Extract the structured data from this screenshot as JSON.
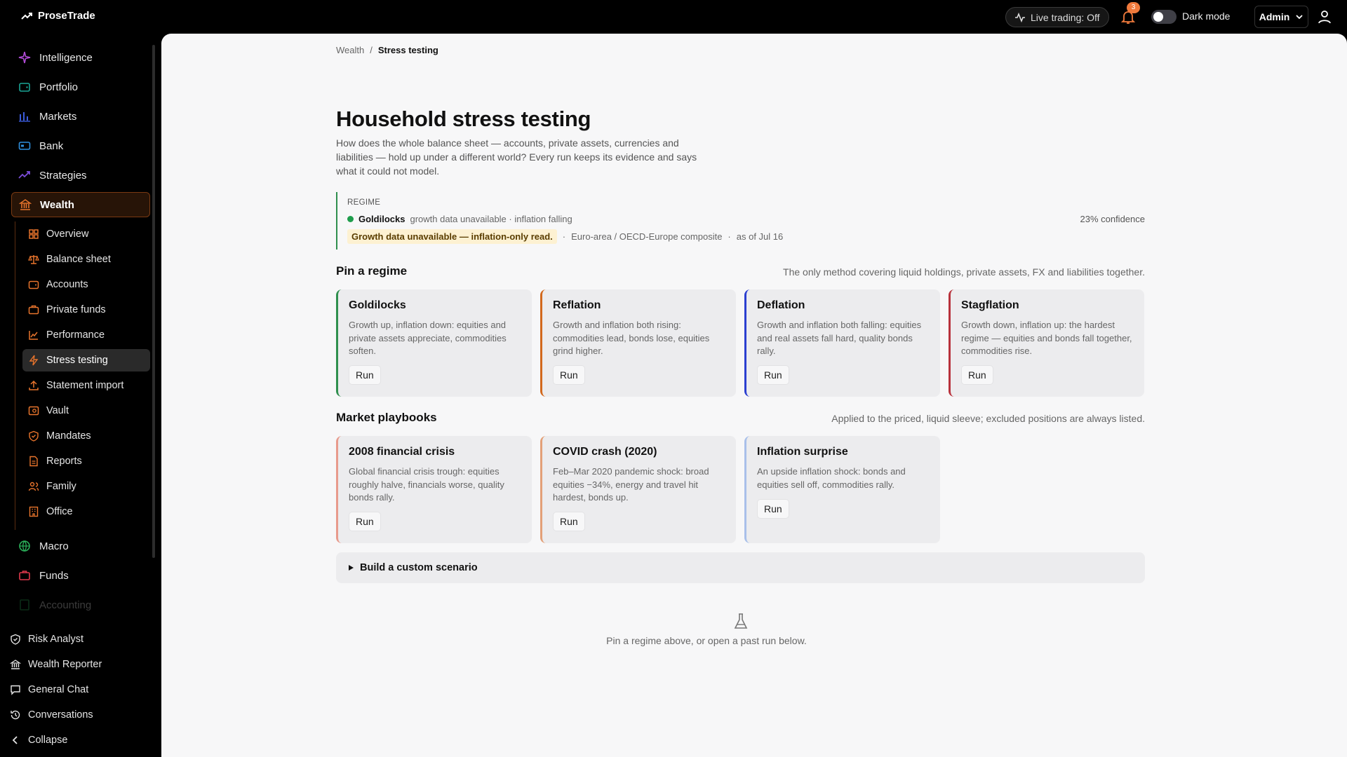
{
  "app": {
    "name": "ProseTrade"
  },
  "topbar": {
    "live_trading": "Live trading: Off",
    "notification_count": "3",
    "dark_mode_label": "Dark mode",
    "user_menu": "Admin"
  },
  "sidebar": {
    "items": [
      {
        "label": "Intelligence",
        "icon": "sparkle-icon",
        "color": "#b04bd6"
      },
      {
        "label": "Portfolio",
        "icon": "wallet-icon",
        "color": "#1aa595"
      },
      {
        "label": "Markets",
        "icon": "bar-chart-icon",
        "color": "#3b5bdb"
      },
      {
        "label": "Bank",
        "icon": "card-icon",
        "color": "#2f8fdd"
      },
      {
        "label": "Strategies",
        "icon": "trend-up-icon",
        "color": "#7c4ddb"
      },
      {
        "label": "Wealth",
        "icon": "bank-icon",
        "color": "#e8742c"
      }
    ],
    "wealth_sub": [
      {
        "label": "Overview",
        "icon": "grid-icon"
      },
      {
        "label": "Balance sheet",
        "icon": "scale-icon"
      },
      {
        "label": "Accounts",
        "icon": "wallet-icon"
      },
      {
        "label": "Private funds",
        "icon": "briefcase-icon"
      },
      {
        "label": "Performance",
        "icon": "line-chart-icon"
      },
      {
        "label": "Stress testing",
        "icon": "bolt-icon"
      },
      {
        "label": "Statement import",
        "icon": "upload-icon"
      },
      {
        "label": "Vault",
        "icon": "vault-icon"
      },
      {
        "label": "Mandates",
        "icon": "shield-check-icon"
      },
      {
        "label": "Reports",
        "icon": "document-icon"
      },
      {
        "label": "Family",
        "icon": "users-icon"
      },
      {
        "label": "Office",
        "icon": "building-icon"
      }
    ],
    "more_items": [
      {
        "label": "Macro",
        "icon": "globe-icon",
        "color": "#2bb05a"
      },
      {
        "label": "Funds",
        "icon": "briefcase-icon",
        "color": "#e0394c"
      },
      {
        "label": "Accounting",
        "icon": "ledger-icon",
        "color": "#2bb05a"
      }
    ],
    "bottom": [
      {
        "label": "Risk Analyst",
        "icon": "shield-icon"
      },
      {
        "label": "Wealth Reporter",
        "icon": "bank-icon"
      },
      {
        "label": "General Chat",
        "icon": "chat-icon"
      },
      {
        "label": "Conversations",
        "icon": "history-icon"
      },
      {
        "label": "Collapse",
        "icon": "chevron-left-icon"
      }
    ],
    "accent": "#e8742c"
  },
  "breadcrumb": {
    "parent": "Wealth",
    "separator": "/",
    "current": "Stress testing"
  },
  "page": {
    "title": "Household stress testing",
    "intro": "How does the whole balance sheet — accounts, private assets, currencies and liabilities — hold up under a different world? Every run keeps its evidence and says what it could not model."
  },
  "regime": {
    "label": "REGIME",
    "name": "Goldilocks",
    "detail": "growth data unavailable · inflation falling",
    "confidence": "23% confidence",
    "warning": "Growth data unavailable — inflation-only read.",
    "source": "Euro-area / OECD-Europe composite",
    "asof": "as of Jul 16",
    "dot_sep": "·"
  },
  "pin_section": {
    "title": "Pin a regime",
    "note": "The only method covering liquid holdings, private assets, FX and liabilities together.",
    "cards": [
      {
        "title": "Goldilocks",
        "desc": "Growth up, inflation down: equities and private assets appreciate, commodities soften.",
        "run": "Run",
        "color": "#2f8f4e"
      },
      {
        "title": "Reflation",
        "desc": "Growth and inflation both rising: commodities lead, bonds lose, equities grind higher.",
        "run": "Run",
        "color": "#d2691e"
      },
      {
        "title": "Deflation",
        "desc": "Growth and inflation both falling: equities and real assets fall hard, quality bonds rally.",
        "run": "Run",
        "color": "#2b3fd0"
      },
      {
        "title": "Stagflation",
        "desc": "Growth down, inflation up: the hardest regime — equities and bonds fall together, commodities rise.",
        "run": "Run",
        "color": "#b8323c"
      }
    ]
  },
  "playbooks": {
    "title": "Market playbooks",
    "note": "Applied to the priced, liquid sleeve; excluded positions are always listed.",
    "cards": [
      {
        "title": "2008 financial crisis",
        "desc": "Global financial crisis trough: equities roughly halve, financials worse, quality bonds rally.",
        "run": "Run",
        "color": "#e89a8c"
      },
      {
        "title": "COVID crash (2020)",
        "desc": "Feb–Mar 2020 pandemic shock: broad equities −34%, energy and travel hit hardest, bonds up.",
        "run": "Run",
        "color": "#e3a078"
      },
      {
        "title": "Inflation surprise",
        "desc": "An upside inflation shock: bonds and equities sell off, commodities rally.",
        "run": "Run",
        "color": "#a9c0ea"
      }
    ]
  },
  "custom": {
    "label": "Build a custom scenario"
  },
  "empty": {
    "text": "Pin a regime above, or open a past run below.",
    "icon": "flask-icon"
  }
}
